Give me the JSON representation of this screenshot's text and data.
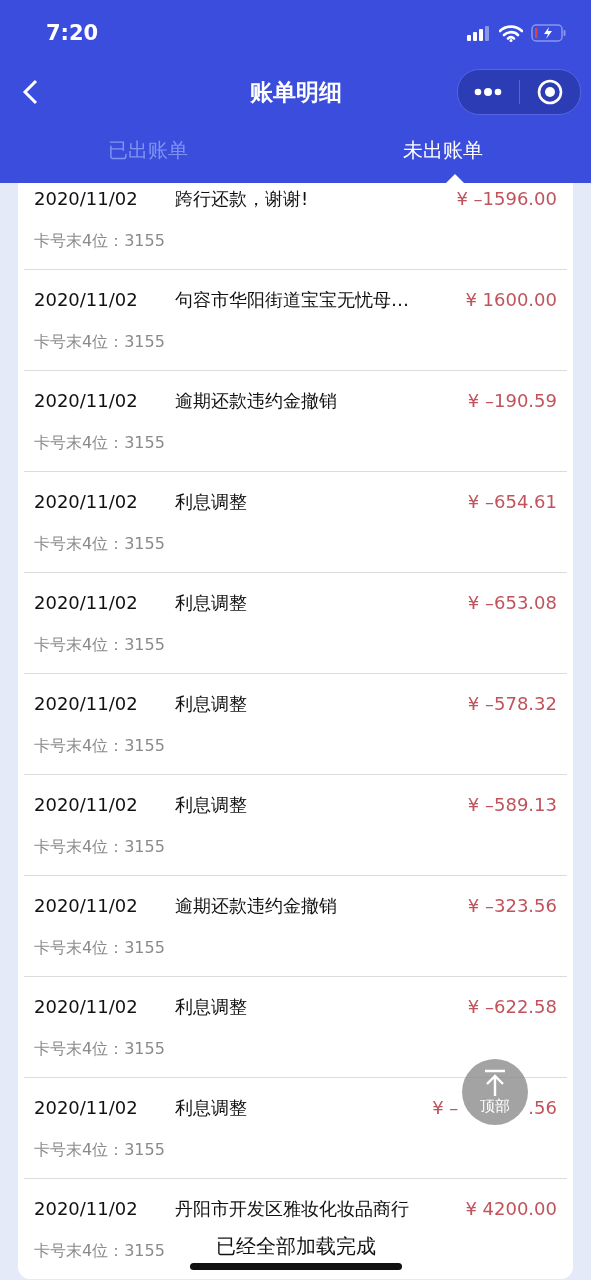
{
  "status_bar": {
    "time": "7:20"
  },
  "nav": {
    "title": "账单明细"
  },
  "tabs": [
    {
      "label": "已出账单",
      "selected": false
    },
    {
      "label": "未出账单",
      "selected": true
    }
  ],
  "transactions": [
    {
      "date": "2020/11/02",
      "description": "跨行还款，谢谢!",
      "amount": "¥ –1596.00",
      "card": "卡号末4位：3155"
    },
    {
      "date": "2020/11/02",
      "description": "句容市华阳街道宝宝无忧母…",
      "amount": "¥ 1600.00",
      "card": "卡号末4位：3155"
    },
    {
      "date": "2020/11/02",
      "description": "逾期还款违约金撤销",
      "amount": "¥ –190.59",
      "card": "卡号末4位：3155"
    },
    {
      "date": "2020/11/02",
      "description": "利息调整",
      "amount": "¥ –654.61",
      "card": "卡号末4位：3155"
    },
    {
      "date": "2020/11/02",
      "description": "利息调整",
      "amount": "¥ –653.08",
      "card": "卡号末4位：3155"
    },
    {
      "date": "2020/11/02",
      "description": "利息调整",
      "amount": "¥ –578.32",
      "card": "卡号末4位：3155"
    },
    {
      "date": "2020/11/02",
      "description": "利息调整",
      "amount": "¥ –589.13",
      "card": "卡号末4位：3155"
    },
    {
      "date": "2020/11/02",
      "description": "逾期还款违约金撤销",
      "amount": "¥ –323.56",
      "card": "卡号末4位：3155"
    },
    {
      "date": "2020/11/02",
      "description": "利息调整",
      "amount": "¥ –622.58",
      "card": "卡号末4位：3155"
    },
    {
      "date": "2020/11/02",
      "description": "利息调整",
      "amount": "¥ –",
      "amount_tail": ".56",
      "card": "卡号末4位：3155"
    },
    {
      "date": "2020/11/02",
      "description": "丹阳市开发区雅妆化妆品商行",
      "amount": "¥ 4200.00",
      "card": "卡号末4位：3155"
    }
  ],
  "back_to_top": {
    "label": "顶部"
  },
  "footer": {
    "text": "已经全部加载完成"
  }
}
